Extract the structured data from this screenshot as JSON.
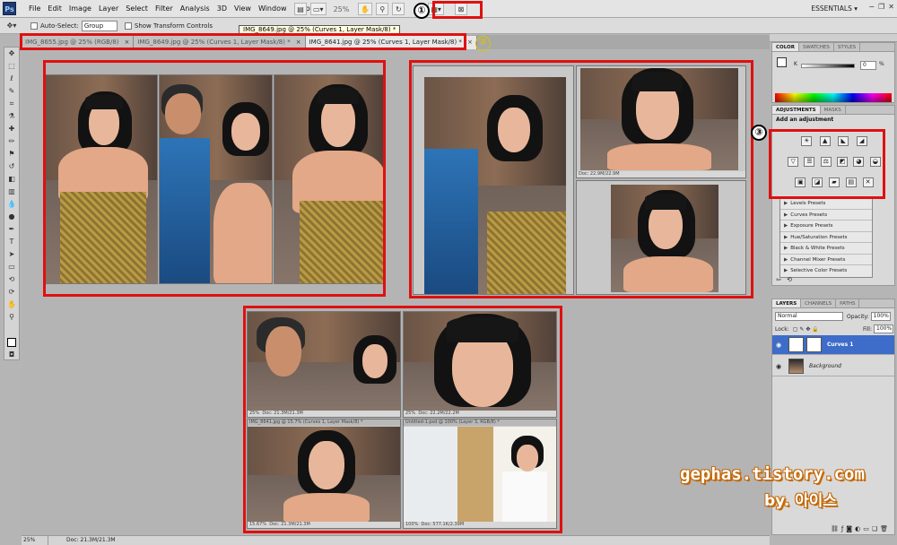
{
  "app": {
    "logo": "Ps",
    "menus": [
      "File",
      "Edit",
      "Image",
      "Layer",
      "Select",
      "Filter",
      "Analysis",
      "3D",
      "View",
      "Window",
      "Help"
    ],
    "zoom": "25%",
    "workspace": "ESSENTIALS",
    "window_buttons": [
      "−",
      "❐",
      "✕"
    ]
  },
  "options": {
    "auto_select_label": "Auto-Select:",
    "auto_select_value": "Group",
    "show_transform_label": "Show Transform Controls"
  },
  "tooltip": "IMG_8649.jpg @ 25% (Curves 1, Layer Mask/8) *",
  "tabs": [
    {
      "label": "IMG_8655.jpg @ 25% (RGB/8)",
      "close": "×"
    },
    {
      "label": "IMG_8649.jpg @ 25% (Curves 1, Layer Mask/8) *",
      "close": "×"
    },
    {
      "label": "IMG_8641.jpg @ 25% (Curves 1, Layer Mask/8) *",
      "close": "×"
    }
  ],
  "mini_windows": {
    "br_title_1": "IMG_8641.jpg @ 15.7% (Curves 1, Layer Mask/8) *",
    "br_title_2": "Untitled-1.psd @ 100% (Layer 3, RGB/8) *",
    "tr_status_1": "Doc: 22.9M/22.9M",
    "tr_status_2": "Doc: 21.3M/21.3M",
    "br_status_1": "Doc: 21.3M/21.3M",
    "br_status_2": "Doc: 22.2M/22.2M",
    "br_status_3": "Doc: 21.3M/21.3M",
    "br_status_4": "Doc: 577.1K/2.39M",
    "zoom_a": "25%",
    "zoom_b": "15.67%",
    "zoom_c": "100%"
  },
  "color_panel": {
    "tabs": [
      "COLOR",
      "SWATCHES",
      "STYLES"
    ],
    "k_label": "K",
    "k_value": "0",
    "k_unit": "%"
  },
  "adjustments_panel": {
    "tabs": [
      "ADJUSTMENTS",
      "MASKS"
    ],
    "heading": "Add an adjustment",
    "icon_rows": [
      [
        "☀",
        "▲",
        "◣",
        "◢"
      ],
      [
        "▽",
        "☰",
        "⚖",
        "◩",
        "◕",
        "◒"
      ],
      [
        "▣",
        "◪",
        "▰",
        "▤",
        "✕"
      ]
    ],
    "presets": [
      "Levels Presets",
      "Curves Presets",
      "Exposure Presets",
      "Hue/Saturation Presets",
      "Black & White Presets",
      "Channel Mixer Presets",
      "Selective Color Presets"
    ]
  },
  "layers_panel": {
    "tabs": [
      "LAYERS",
      "CHANNELS",
      "PATHS"
    ],
    "blend_mode": "Normal",
    "opacity_label": "Opacity:",
    "opacity_value": "100%",
    "lock_label": "Lock:",
    "fill_label": "Fill:",
    "fill_value": "100%",
    "layers": [
      {
        "name": "Curves 1",
        "selected": true
      },
      {
        "name": "Background",
        "selected": false
      }
    ]
  },
  "status": {
    "zoom": "25%",
    "doc": "Doc: 21.3M/21.3M"
  },
  "annotations": {
    "one": "①",
    "two": "②",
    "three": "③",
    "watermark": "gephas.tistory.com",
    "watermark_by": "by. 아이스"
  },
  "colors": {
    "highlight": "#e01010",
    "selected_layer": "#3d6cc9",
    "watermark_outline": "#c46a0a"
  }
}
